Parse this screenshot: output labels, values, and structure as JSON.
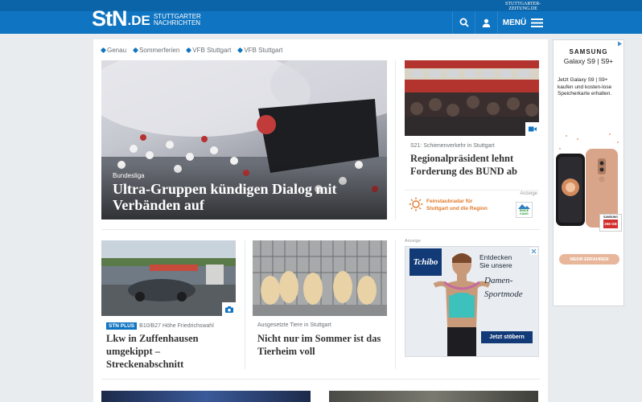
{
  "header": {
    "logo_main": "StN",
    "logo_tld": ".DE",
    "logo_sub_line1": "STUTTGARTER",
    "logo_sub_line2": "NACHRICHTEN",
    "partner_line1": "STUTTGARTER-",
    "partner_line2": "ZEITUNG.DE",
    "menu_label": "MENÜ",
    "colors": {
      "bar": "#0f74c1",
      "bar_dark": "#0c64a8"
    }
  },
  "tags": [
    "Genau",
    "Sommerferien",
    "VFB Stuttgart",
    "VFB Stuttgart"
  ],
  "hero": {
    "kicker": "Bundesliga",
    "title": "Ultra-Gruppen kündigen Dialog mit Verbänden auf"
  },
  "side_story": {
    "kicker": "S21: Schienenverkehr in Stuttgart",
    "title": "Regionalpräsident lehnt Forderung des BUND ab"
  },
  "promo": {
    "label": "Anzeige",
    "line1": "Feinstaubradar für",
    "line2": "Stuttgart und die Region",
    "logo_line1": "BINDE",
    "logo_line2": "KANG"
  },
  "stories": [
    {
      "badge": "STN PLUS",
      "kicker": "B10/B27 Höhe Friedrichswahl",
      "title": "Lkw in Zuffenhausen umgekippt – Streckenabschnitt"
    },
    {
      "kicker": "Ausgesetzte Tiere in Stuttgart",
      "title": "Nicht nur im Sommer ist das Tierheim voll"
    }
  ],
  "tchibo_ad": {
    "label": "Anzeige",
    "brand": "Tchibo",
    "line1": "Entdecken",
    "line2": "Sie unsere",
    "script1": "Damen-",
    "script2": "Sportmode",
    "cta": "Jetzt stöbern"
  },
  "samsung_ad": {
    "brand": "SAMSUNG",
    "model": "Galaxy S9 | S9+",
    "copy": "Jetzt Galaxy S9 | S9+ kaufen und kosten-lose Speicherkarte erhalten.",
    "card_brand": "SAMSUNG",
    "card_size": "256 GB",
    "cta": "MEHR ERFAHREN"
  }
}
